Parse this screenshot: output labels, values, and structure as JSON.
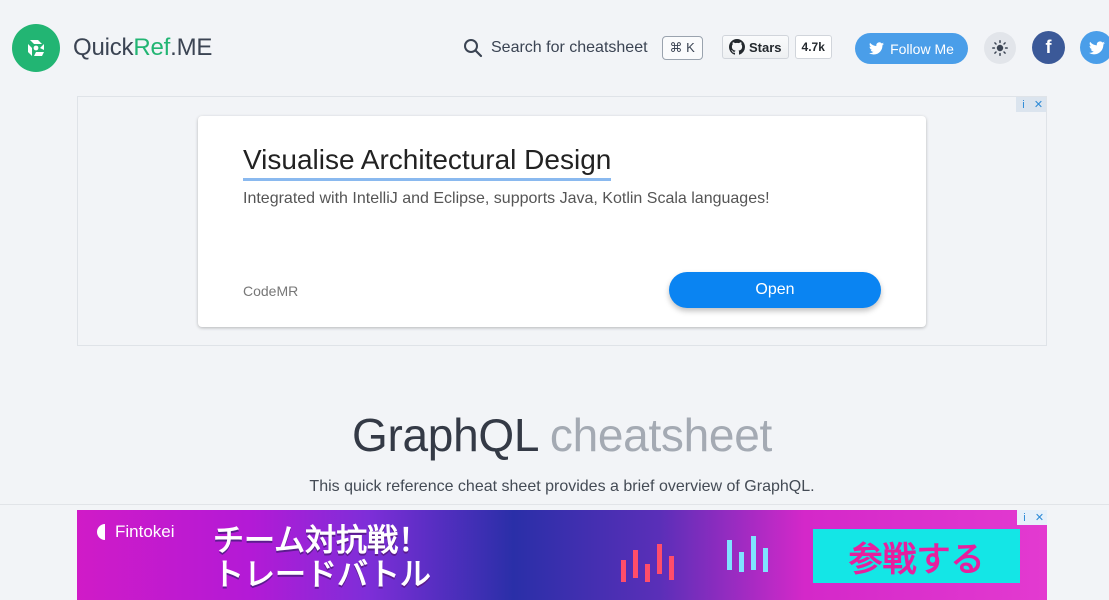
{
  "header": {
    "logo_main": "QuickRef",
    "logo_dot": ".ME",
    "search_label": "Search for cheatsheet",
    "search_kbd": "⌘ K",
    "github_label": "Stars",
    "github_count": "4.7k",
    "follow_label": "Follow Me",
    "facebook_glyph": "f"
  },
  "ad1": {
    "title": "Visualise Architectural Design",
    "description": "Integrated with IntelliJ and Eclipse, supports Java, Kotlin Scala languages!",
    "brand": "CodeMR",
    "cta": "Open",
    "adchoice_info": "i",
    "adchoice_close": "✕"
  },
  "page": {
    "title_main": "GraphQL",
    "title_light": "cheatsheet",
    "subtitle": "This quick reference cheat sheet provides a brief overview of GraphQL."
  },
  "ad2": {
    "brand": "Fintokei",
    "headline_1": "チーム対抗戦！",
    "headline_2": "トレードバトル",
    "cta": "参戦する",
    "adchoice_info": "i",
    "adchoice_close": "✕"
  },
  "colors": {
    "brand_green": "#22b573",
    "follow_blue": "#4a9ee9",
    "ad_cta_blue": "#0a84f2",
    "banner_cta_cyan": "#14e6e6",
    "banner_cta_text": "#e71f9e"
  }
}
